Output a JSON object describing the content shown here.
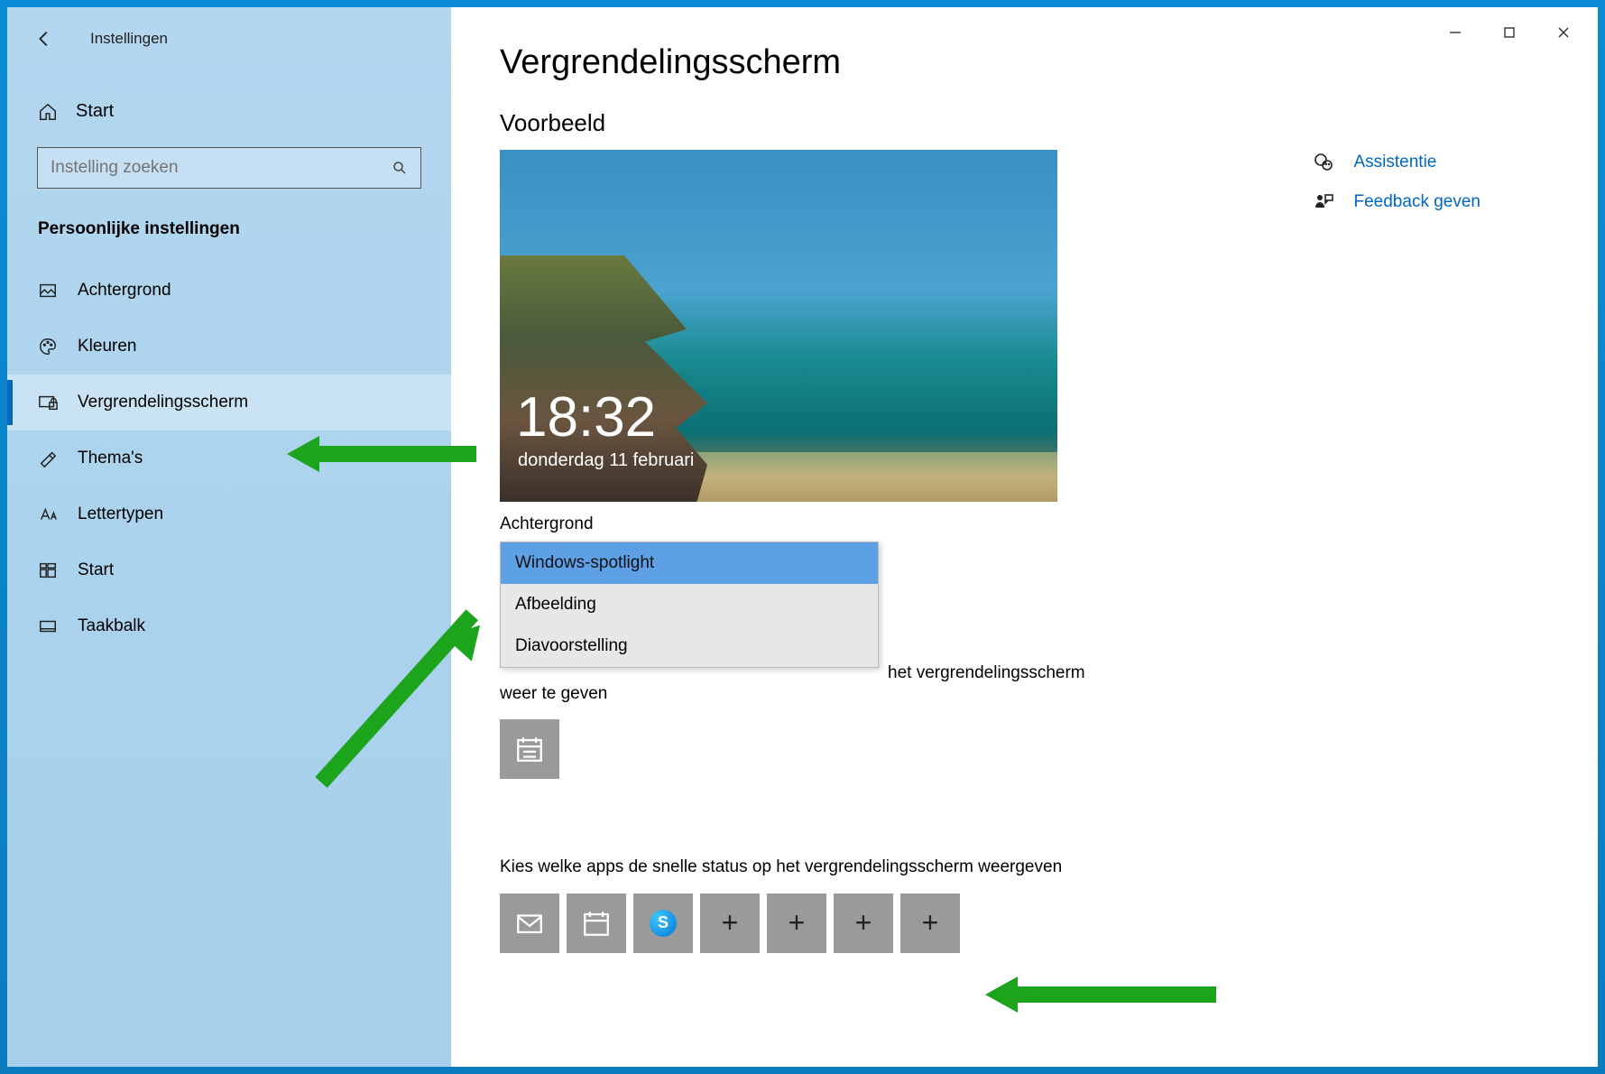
{
  "app_title": "Instellingen",
  "home_label": "Start",
  "search_placeholder": "Instelling zoeken",
  "section_label": "Persoonlijke instellingen",
  "nav": [
    {
      "label": "Achtergrond"
    },
    {
      "label": "Kleuren"
    },
    {
      "label": "Vergrendelingsscherm"
    },
    {
      "label": "Thema's"
    },
    {
      "label": "Lettertypen"
    },
    {
      "label": "Start"
    },
    {
      "label": "Taakbalk"
    }
  ],
  "page_title": "Vergrendelingsscherm",
  "preview_title": "Voorbeeld",
  "preview_time": "18:32",
  "preview_date": "donderdag 11 februari",
  "background_label": "Achtergrond",
  "dropdown_options": {
    "o1": "Windows-spotlight",
    "o2": "Afbeelding",
    "o3": "Diavoorstelling"
  },
  "line_partial_right": "het vergrendelingsscherm",
  "line_partial_bottom": "weer te geven",
  "quick_status_label": "Kies welke apps de snelle status op het vergrendelingsscherm weergeven",
  "right_links": {
    "assist": "Assistentie",
    "feedback": "Feedback geven"
  }
}
